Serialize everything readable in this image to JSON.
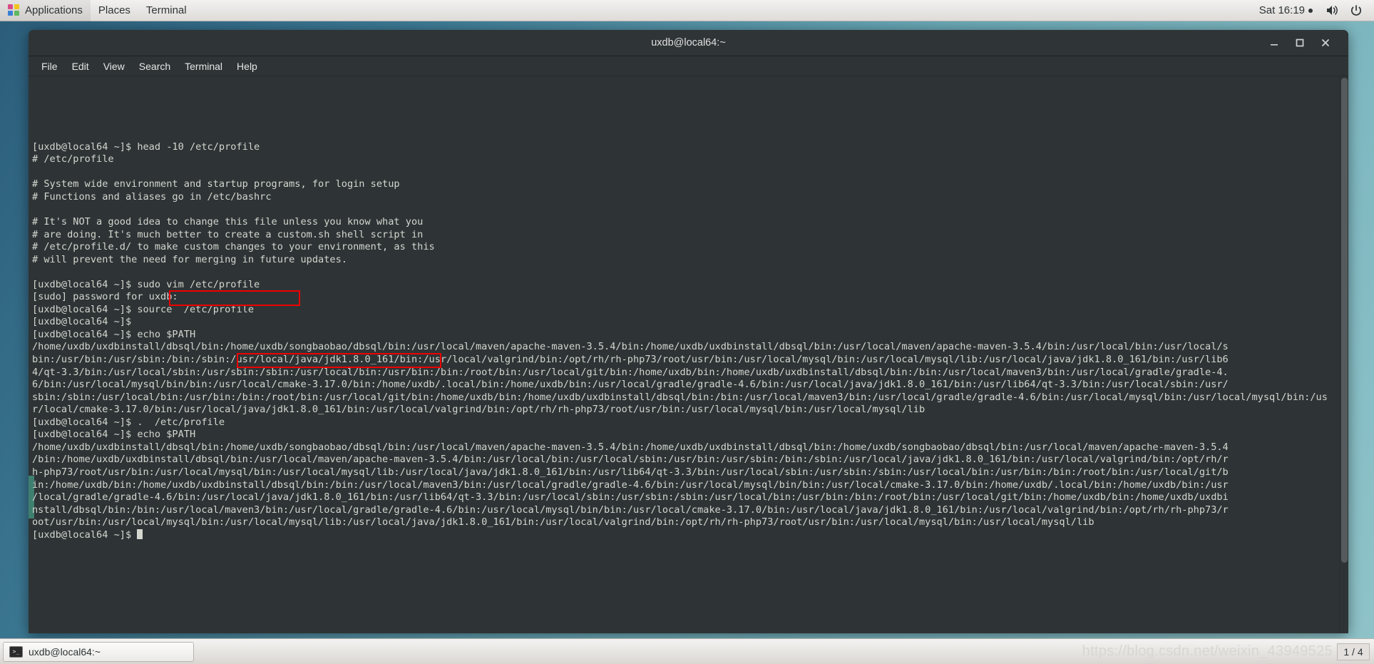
{
  "top_panel": {
    "menus": [
      {
        "label": "Applications",
        "icon": "gnome-foot-icon"
      },
      {
        "label": "Places",
        "icon": null
      },
      {
        "label": "Terminal",
        "icon": null
      }
    ],
    "clock": "Sat 16:19",
    "indicators": [
      "recording-dot",
      "volume-icon",
      "power-icon"
    ]
  },
  "window": {
    "title": "uxdb@local64:~",
    "controls": {
      "minimize": "–",
      "maximize": "□",
      "close": "✕"
    },
    "menubar": [
      "File",
      "Edit",
      "View",
      "Search",
      "Terminal",
      "Help"
    ]
  },
  "terminal": {
    "prompt": "[uxdb@local64 ~]$ ",
    "lines": [
      "[uxdb@local64 ~]$ head -10 /etc/profile",
      "# /etc/profile",
      "",
      "# System wide environment and startup programs, for login setup",
      "# Functions and aliases go in /etc/bashrc",
      "",
      "# It's NOT a good idea to change this file unless you know what you",
      "# are doing. It's much better to create a custom.sh shell script in",
      "# /etc/profile.d/ to make custom changes to your environment, as this",
      "# will prevent the need for merging in future updates.",
      "",
      "[uxdb@local64 ~]$ sudo vim /etc/profile",
      "[sudo] password for uxdb:",
      "[uxdb@local64 ~]$ source  /etc/profile",
      "[uxdb@local64 ~]$",
      "[uxdb@local64 ~]$ echo $PATH",
      "/home/uxdb/uxdbinstall/dbsql/bin:/home/uxdb/songbaobao/dbsql/bin:/usr/local/maven/apache-maven-3.5.4/bin:/home/uxdb/uxdbinstall/dbsql/bin:/usr/local/maven/apache-maven-3.5.4/bin:/usr/local/bin:/usr/local/s",
      "bin:/usr/bin:/usr/sbin:/bin:/sbin:/usr/local/java/jdk1.8.0_161/bin:/usr/local/valgrind/bin:/opt/rh/rh-php73/root/usr/bin:/usr/local/mysql/bin:/usr/local/mysql/lib:/usr/local/java/jdk1.8.0_161/bin:/usr/lib6",
      "4/qt-3.3/bin:/usr/local/sbin:/usr/sbin:/sbin:/usr/local/bin:/usr/bin:/bin:/root/bin:/usr/local/git/bin:/home/uxdb/bin:/home/uxdb/uxdbinstall/dbsql/bin:/bin:/usr/local/maven3/bin:/usr/local/gradle/gradle-4.",
      "6/bin:/usr/local/mysql/bin/bin:/usr/local/cmake-3.17.0/bin:/home/uxdb/.local/bin:/home/uxdb/bin:/usr/local/gradle/gradle-4.6/bin:/usr/local/java/jdk1.8.0_161/bin:/usr/lib64/qt-3.3/bin:/usr/local/sbin:/usr/",
      "sbin:/sbin:/usr/local/bin:/usr/bin:/bin:/root/bin:/usr/local/git/bin:/home/uxdb/bin:/home/uxdb/uxdbinstall/dbsql/bin:/bin:/usr/local/maven3/bin:/usr/local/gradle/gradle-4.6/bin:/usr/local/mysql/bin:/usr/local/mysql/bin:/us",
      "r/local/cmake-3.17.0/bin:/usr/local/java/jdk1.8.0_161/bin:/usr/local/valgrind/bin:/opt/rh/rh-php73/root/usr/bin:/usr/local/mysql/bin:/usr/local/mysql/lib",
      "[uxdb@local64 ~]$ .  /etc/profile",
      "[uxdb@local64 ~]$ echo $PATH",
      "/home/uxdb/uxdbinstall/dbsql/bin:/home/uxdb/songbaobao/dbsql/bin:/usr/local/maven/apache-maven-3.5.4/bin:/home/uxdb/uxdbinstall/dbsql/bin:/home/uxdb/songbaobao/dbsql/bin:/usr/local/maven/apache-maven-3.5.4",
      "/bin:/home/uxdb/uxdbinstall/dbsql/bin:/usr/local/maven/apache-maven-3.5.4/bin:/usr/local/bin:/usr/local/sbin:/usr/bin:/usr/sbin:/bin:/sbin:/usr/local/java/jdk1.8.0_161/bin:/usr/local/valgrind/bin:/opt/rh/r",
      "h-php73/root/usr/bin:/usr/local/mysql/bin:/usr/local/mysql/lib:/usr/local/java/jdk1.8.0_161/bin:/usr/lib64/qt-3.3/bin:/usr/local/sbin:/usr/sbin:/sbin:/usr/local/bin:/usr/bin:/bin:/root/bin:/usr/local/git/b",
      "in:/home/uxdb/bin:/home/uxdb/uxdbinstall/dbsql/bin:/bin:/usr/local/maven3/bin:/usr/local/gradle/gradle-4.6/bin:/usr/local/mysql/bin/bin:/usr/local/cmake-3.17.0/bin:/home/uxdb/.local/bin:/home/uxdb/bin:/usr",
      "/local/gradle/gradle-4.6/bin:/usr/local/java/jdk1.8.0_161/bin:/usr/lib64/qt-3.3/bin:/usr/local/sbin:/usr/sbin:/sbin:/usr/local/bin:/usr/bin:/bin:/root/bin:/usr/local/git/bin:/home/uxdb/bin:/home/uxdb/uxdbi",
      "nstall/dbsql/bin:/bin:/usr/local/maven3/bin:/usr/local/gradle/gradle-4.6/bin:/usr/local/mysql/bin/bin:/usr/local/cmake-3.17.0/bin:/usr/local/java/jdk1.8.0_161/bin:/usr/local/valgrind/bin:/opt/rh/rh-php73/r",
      "oot/usr/bin:/usr/local/mysql/bin:/usr/local/mysql/lib:/usr/local/java/jdk1.8.0_161/bin:/usr/local/valgrind/bin:/opt/rh/rh-php73/root/usr/bin:/usr/local/mysql/bin:/usr/local/mysql/lib",
      "[uxdb@local64 ~]$ "
    ],
    "annotations": [
      {
        "label": "sudo vim /etc/profile",
        "box": "highlight-command-box"
      },
      {
        "label": "/home/uxdb/songbaobao/dbsql/bin:",
        "box": "highlight-path-box"
      }
    ],
    "colors": {
      "background": "#2e3436",
      "foreground": "#d3d7cf",
      "annotation": "#ee0000"
    }
  },
  "bottom_panel": {
    "task_label": "uxdb@local64:~",
    "task_icon": "terminal-icon",
    "watermark": "https://blog.csdn.net/weixin_43949525",
    "workspace": "1 / 4"
  }
}
